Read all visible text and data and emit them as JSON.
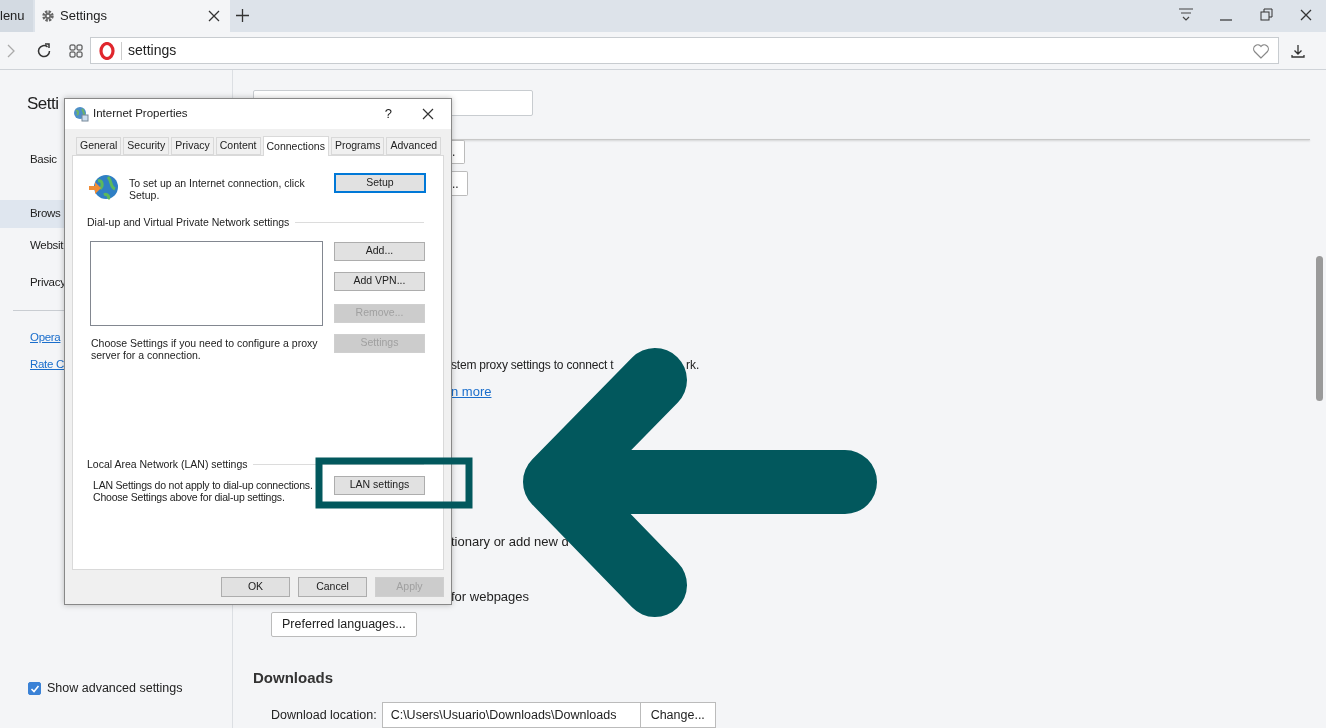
{
  "browser": {
    "tabs": [
      {
        "label": "lenu",
        "selected": false
      },
      {
        "label": "Settings",
        "selected": true
      }
    ],
    "address": {
      "value": "settings"
    }
  },
  "sidebar": {
    "title": "Setti",
    "items": [
      {
        "label": "Basic",
        "selected": false
      },
      {
        "label": "Brows",
        "selected": true
      },
      {
        "label": "Websit",
        "selected": false
      },
      {
        "label": "Privacy",
        "selected": false
      }
    ],
    "links": [
      "Opera",
      "Rate C"
    ],
    "show_advanced": {
      "label": "Show advanced settings",
      "checked": true
    }
  },
  "main": {
    "partial_buttons": [
      ".",
      ".."
    ],
    "proxy_text": [
      "stem proxy settings to connect t",
      "rk."
    ],
    "learn_more": "n more",
    "dictionary_text": "tionary or add new d",
    "webpages_text": "for webpages",
    "preferred_languages_button": "Preferred languages...",
    "downloads": {
      "heading": "Downloads",
      "location_label": "Download location:",
      "location_value": "C:\\Users\\Usuario\\Downloads\\Downloads",
      "change_button": "Change..."
    }
  },
  "dialog": {
    "title": "Internet Properties",
    "help": "?",
    "tabs": [
      {
        "label": "General",
        "selected": false
      },
      {
        "label": "Security",
        "selected": false
      },
      {
        "label": "Privacy",
        "selected": false
      },
      {
        "label": "Content",
        "selected": false
      },
      {
        "label": "Connections",
        "selected": true
      },
      {
        "label": "Programs",
        "selected": false
      },
      {
        "label": "Advanced",
        "selected": false
      }
    ],
    "setup_text": "To set up an Internet connection, click Setup.",
    "setup_button": "Setup",
    "vpn_group": "Dial-up and Virtual Private Network settings",
    "vpn_buttons": [
      {
        "label": "Add...",
        "disabled": false
      },
      {
        "label": "Add VPN...",
        "disabled": false
      },
      {
        "label": "Remove...",
        "disabled": true
      },
      {
        "label": "Settings",
        "disabled": true
      }
    ],
    "proxy_note": "Choose Settings if you need to configure a proxy server for a connection.",
    "lan_group": "Local Area Network (LAN) settings",
    "lan_note": "LAN Settings do not apply to dial-up connections. Choose Settings above for dial-up settings.",
    "lan_button": "LAN settings",
    "footer_buttons": [
      {
        "label": "OK",
        "disabled": false
      },
      {
        "label": "Cancel",
        "disabled": false
      },
      {
        "label": "Apply",
        "disabled": true
      }
    ]
  }
}
